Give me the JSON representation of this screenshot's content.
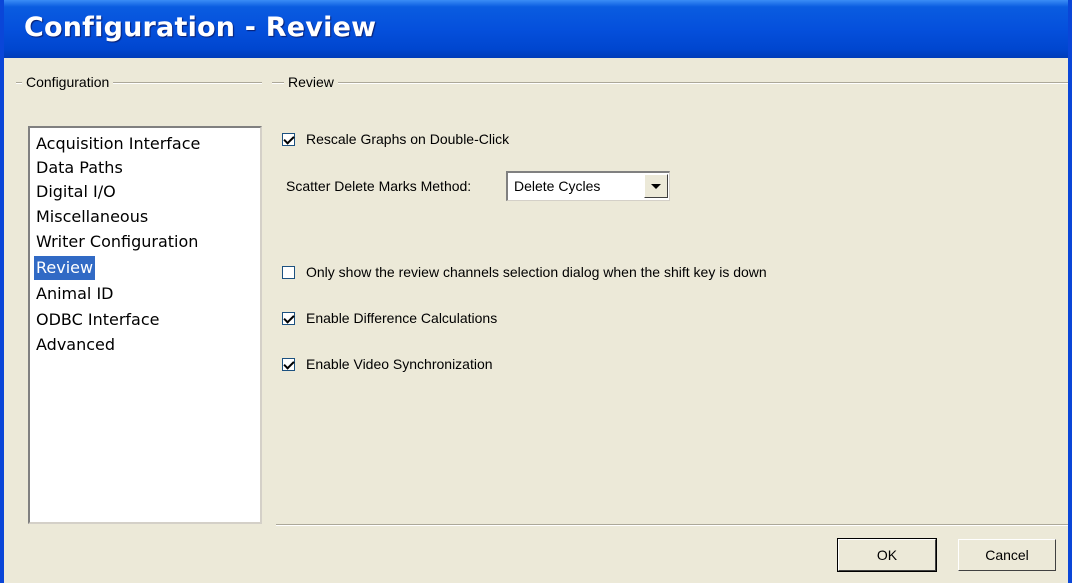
{
  "window": {
    "title": "Configuration - Review"
  },
  "config_group": {
    "label": "Configuration",
    "items": [
      {
        "label": "Acquisition Interface",
        "selected": false
      },
      {
        "label": "Data Paths",
        "selected": false
      },
      {
        "label": "Digital I/O",
        "selected": false
      },
      {
        "label": "Miscellaneous",
        "selected": false
      },
      {
        "label": "Writer Configuration",
        "selected": false
      },
      {
        "label": "Review",
        "selected": true
      },
      {
        "label": "Animal ID",
        "selected": false
      },
      {
        "label": "ODBC Interface",
        "selected": false
      },
      {
        "label": "Advanced",
        "selected": false
      }
    ]
  },
  "review_group": {
    "label": "Review",
    "rescale": {
      "label": "Rescale Graphs on Double-Click",
      "checked": true
    },
    "scatter": {
      "label": "Scatter Delete Marks Method:",
      "value": "Delete Cycles"
    },
    "shift_dialog": {
      "label": "Only show the review channels selection dialog when the shift key is down",
      "checked": false
    },
    "difference": {
      "label": "Enable Difference Calculations",
      "checked": true
    },
    "video": {
      "label": "Enable Video Synchronization",
      "checked": true
    }
  },
  "buttons": {
    "ok": "OK",
    "cancel": "Cancel"
  },
  "colors": {
    "titlebar": "#0550DC",
    "selection": "#316AC5",
    "dialog_bg": "#ECE9D8"
  }
}
